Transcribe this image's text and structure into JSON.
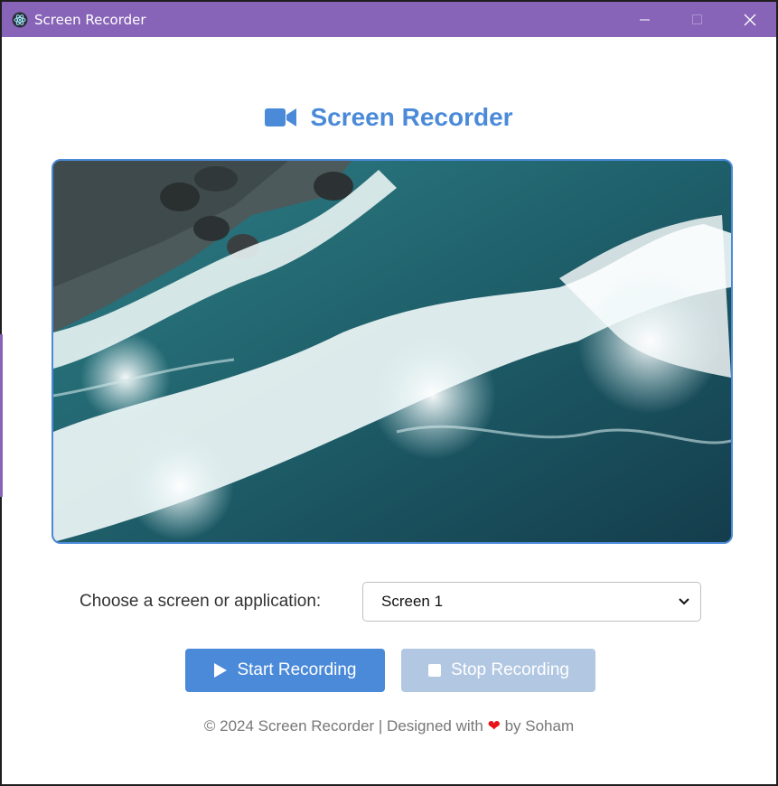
{
  "window": {
    "title": "Screen Recorder",
    "controls": [
      "minimize",
      "maximize",
      "close"
    ]
  },
  "header": {
    "title": "Screen Recorder",
    "icon": "video-camera-icon"
  },
  "chooser": {
    "label": "Choose a screen or application:",
    "selected": "Screen 1"
  },
  "buttons": {
    "start_label": "Start Recording",
    "stop_label": "Stop Recording"
  },
  "footer": {
    "prefix": "© 2024 Screen Recorder | Designed with",
    "suffix": "by Soham"
  },
  "colors": {
    "titlebar": "#8764b8",
    "accent": "#4a8ad9",
    "stop_disabled": "#b1c7e2",
    "heart": "#e8141a"
  }
}
